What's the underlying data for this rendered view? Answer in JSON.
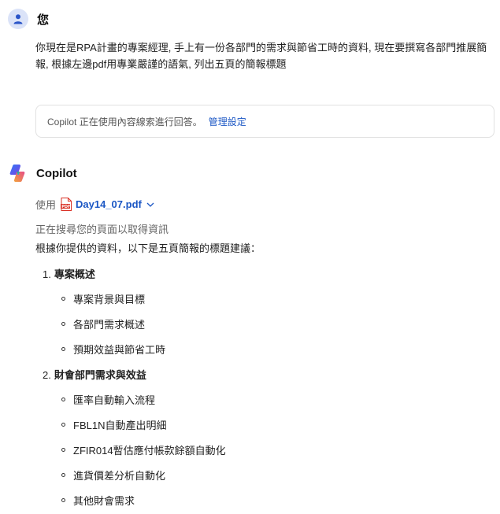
{
  "user": {
    "name": "您",
    "message": "你現在是RPA計畫的專案經理, 手上有一份各部門的需求與節省工時的資料, 現在要撰寫各部門推展簡報, 根據左邊pdf用專業嚴謹的語氣, 列出五頁的簡報標題"
  },
  "notice": {
    "text": "Copilot 正在使用內容線索進行回答。",
    "link": "管理設定"
  },
  "copilot": {
    "name": "Copilot",
    "source_prefix": "使用",
    "source_file": "Day14_07.pdf",
    "status": "正在搜尋您的頁面以取得資訊",
    "intro": "根據你提供的資料，以下是五頁簡報的標題建議：",
    "sections": [
      {
        "number": "1.",
        "title": "專案概述",
        "items": [
          "專案背景與目標",
          "各部門需求概述",
          "預期效益與節省工時"
        ]
      },
      {
        "number": "2.",
        "title": "財會部門需求與效益",
        "items": [
          "匯率自動輸入流程",
          "FBL1N自動產出明細",
          "ZFIR014暫估應付帳款餘額自動化",
          "進貨價差分析自動化",
          "其他財會需求"
        ]
      }
    ]
  },
  "colors": {
    "link": "#1a56c4",
    "avatar_bg": "#dbe3f8",
    "pdf_red": "#d93025"
  }
}
